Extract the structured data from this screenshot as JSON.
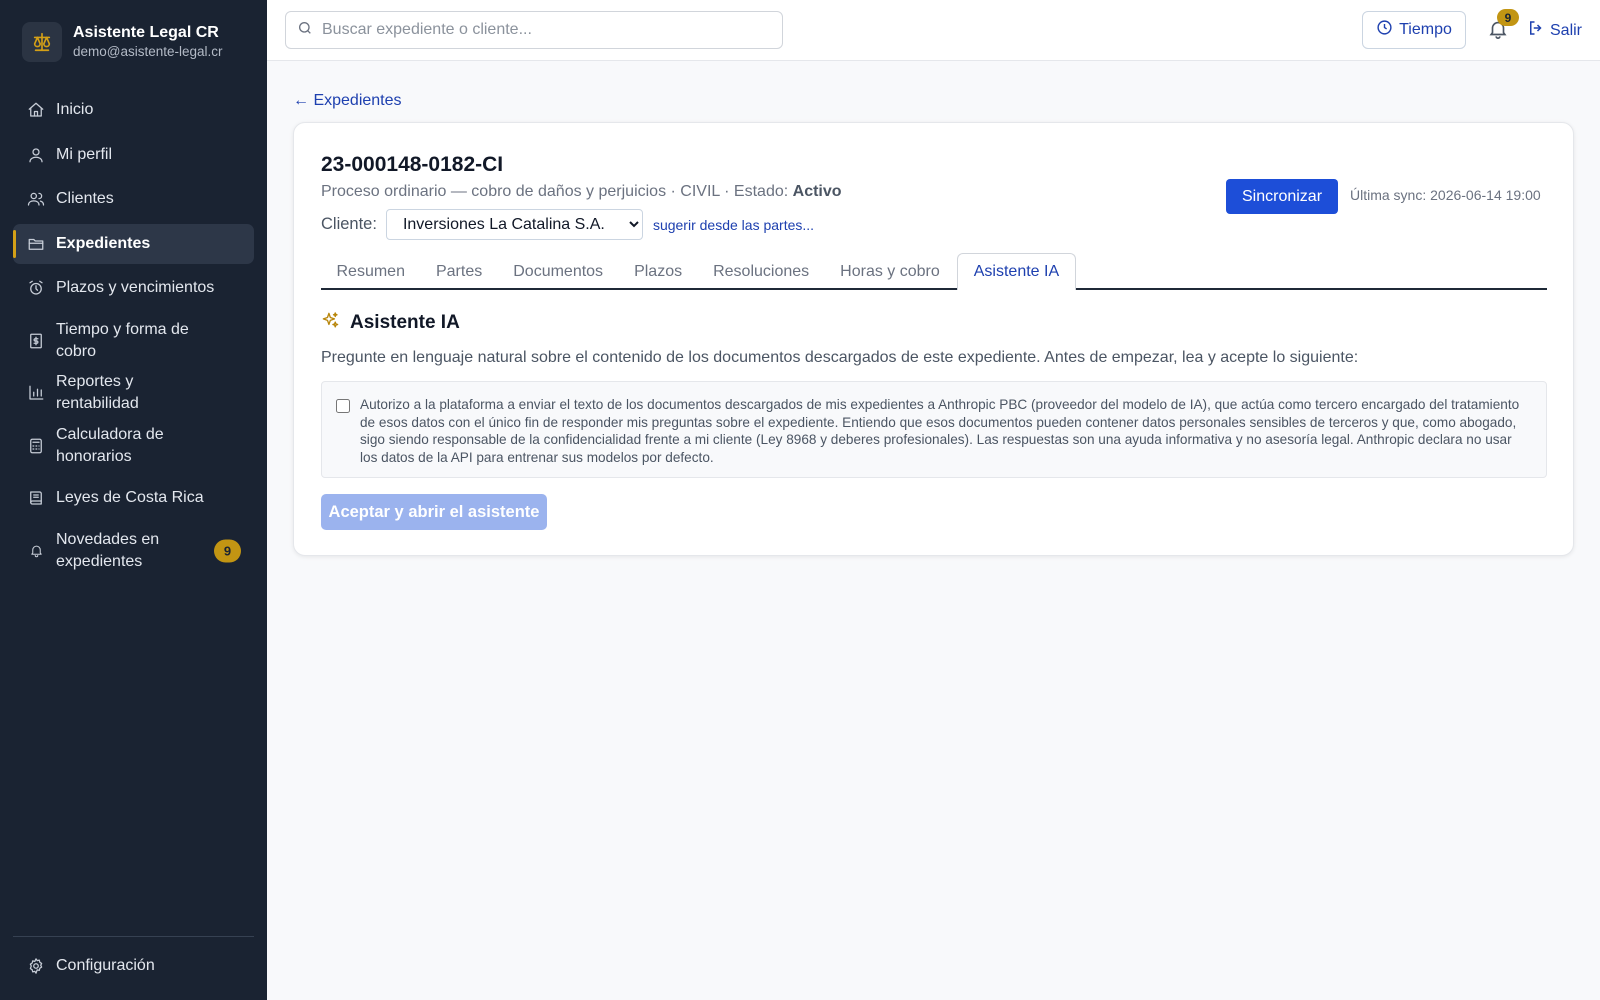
{
  "app": {
    "title": "Asistente Legal CR",
    "email": "demo@asistente-legal.cr"
  },
  "sidebar": {
    "items": [
      {
        "label": "Inicio",
        "icon": "home-icon"
      },
      {
        "label": "Mi perfil",
        "icon": "user-icon"
      },
      {
        "label": "Clientes",
        "icon": "users-icon"
      },
      {
        "label": "Expedientes",
        "icon": "folder-icon",
        "active": true
      },
      {
        "label": "Plazos y vencimientos",
        "icon": "alarm-clock-icon"
      },
      {
        "label": "Tiempo y forma de cobro",
        "icon": "receipt-icon"
      },
      {
        "label": "Reportes y rentabilidad",
        "icon": "bar-chart-icon"
      },
      {
        "label": "Calculadora de honorarios",
        "icon": "calculator-icon"
      },
      {
        "label": "Leyes de Costa Rica",
        "icon": "book-icon"
      },
      {
        "label": "Novedades en expedientes",
        "icon": "bell-icon",
        "badge": "9"
      }
    ],
    "settings_label": "Configuración"
  },
  "topbar": {
    "search_placeholder": "Buscar expediente o cliente...",
    "tiempo_label": "Tiempo",
    "notifications_count": "9",
    "logout_label": "Salir"
  },
  "main": {
    "back_label": "← Expedientes",
    "case": {
      "number": "23-000148-0182-CI",
      "description": "Proceso ordinario — cobro de daños y perjuicios · CIVIL · Estado: ",
      "status": "Activo",
      "client_label": "Cliente:",
      "client_value": "Inversiones La Catalina S.A.",
      "suggest_label": "sugerir desde las partes...",
      "sync_label": "Sincronizar",
      "last_sync": "Última sync: 2026-06-14 19:00"
    },
    "tabs": [
      {
        "label": "Resumen"
      },
      {
        "label": "Partes"
      },
      {
        "label": "Documentos"
      },
      {
        "label": "Plazos"
      },
      {
        "label": "Resoluciones"
      },
      {
        "label": "Horas y cobro"
      },
      {
        "label": "Asistente IA",
        "active": true
      }
    ],
    "assistant": {
      "title": "Asistente IA",
      "intro": "Pregunte en lenguaje natural sobre el contenido de los documentos descargados de este expediente. Antes de empezar, lea y acepte lo siguiente:",
      "consent": "Autorizo a la plataforma a enviar el texto de los documentos descargados de mis expedientes a Anthropic PBC (proveedor del modelo de IA), que actúa como tercero encargado del tratamiento de esos datos con el único fin de responder mis preguntas sobre el expediente. Entiendo que esos documentos pueden contener datos personales sensibles de terceros y que, como abogado, sigo siendo responsable de la confidencialidad frente a mi cliente (Ley 8968 y deberes profesionales). Las respuestas son una ayuda informativa y no asesoría legal. Anthropic declara no usar los datos de la API para entrenar sus modelos por defecto.",
      "accept_label": "Aceptar y abrir el asistente"
    }
  },
  "colors": {
    "sidebar_bg": "#1a2332",
    "accent_gold": "#c29513",
    "primary_blue": "#1d4ed8",
    "link_blue": "#1e40af",
    "disabled_button": "#9bb3ee"
  }
}
